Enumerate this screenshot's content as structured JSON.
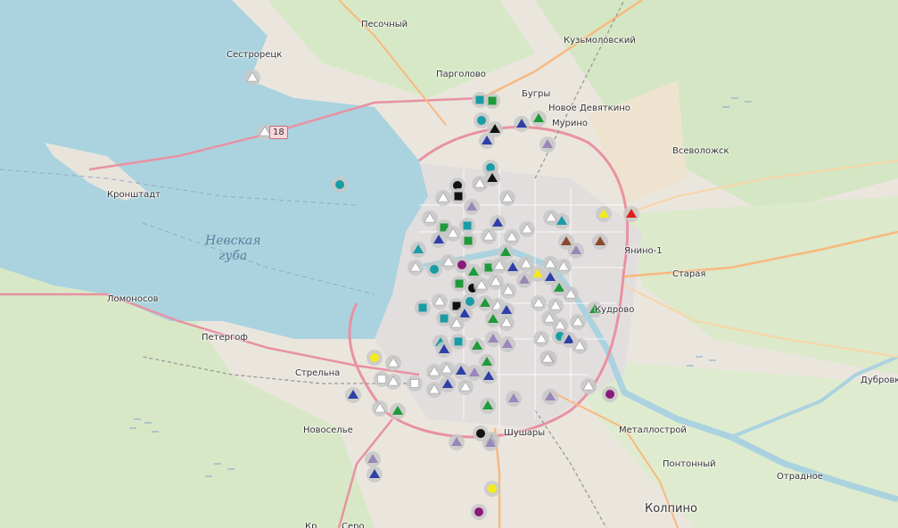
{
  "map": {
    "water_label": [
      "Невская",
      "губа"
    ],
    "road_shield": "18",
    "places": [
      {
        "name": "Песочный"
      },
      {
        "name": "Кузьмоловский"
      },
      {
        "name": "Сестрорецк"
      },
      {
        "name": "Парголово"
      },
      {
        "name": "Бугры"
      },
      {
        "name": "Новое Девяткино"
      },
      {
        "name": "Мурино"
      },
      {
        "name": "Всеволожск"
      },
      {
        "name": "Кронштадт"
      },
      {
        "name": "Янино-1"
      },
      {
        "name": "Старая"
      },
      {
        "name": "Ломоносов"
      },
      {
        "name": "Кудрово"
      },
      {
        "name": "Петергоф"
      },
      {
        "name": "Стрельна"
      },
      {
        "name": "Дубровка"
      },
      {
        "name": "Новоселье"
      },
      {
        "name": "Металлострой"
      },
      {
        "name": "Шушары"
      },
      {
        "name": "Понтонный"
      },
      {
        "name": "Отрадное"
      },
      {
        "name": "Колпино"
      },
      {
        "name": "Кр"
      },
      {
        "name": "Серо"
      }
    ],
    "marker_colors": {
      "white": "#ffffff",
      "blue": "#2f3fa8",
      "green": "#1e9a3a",
      "teal": "#1a9ca5",
      "black": "#111111",
      "purple": "#9a86b8",
      "yellow": "#f3ea1a",
      "red": "#e02020",
      "brown": "#8a4a2a",
      "magenta": "#8a1a7a"
    }
  }
}
